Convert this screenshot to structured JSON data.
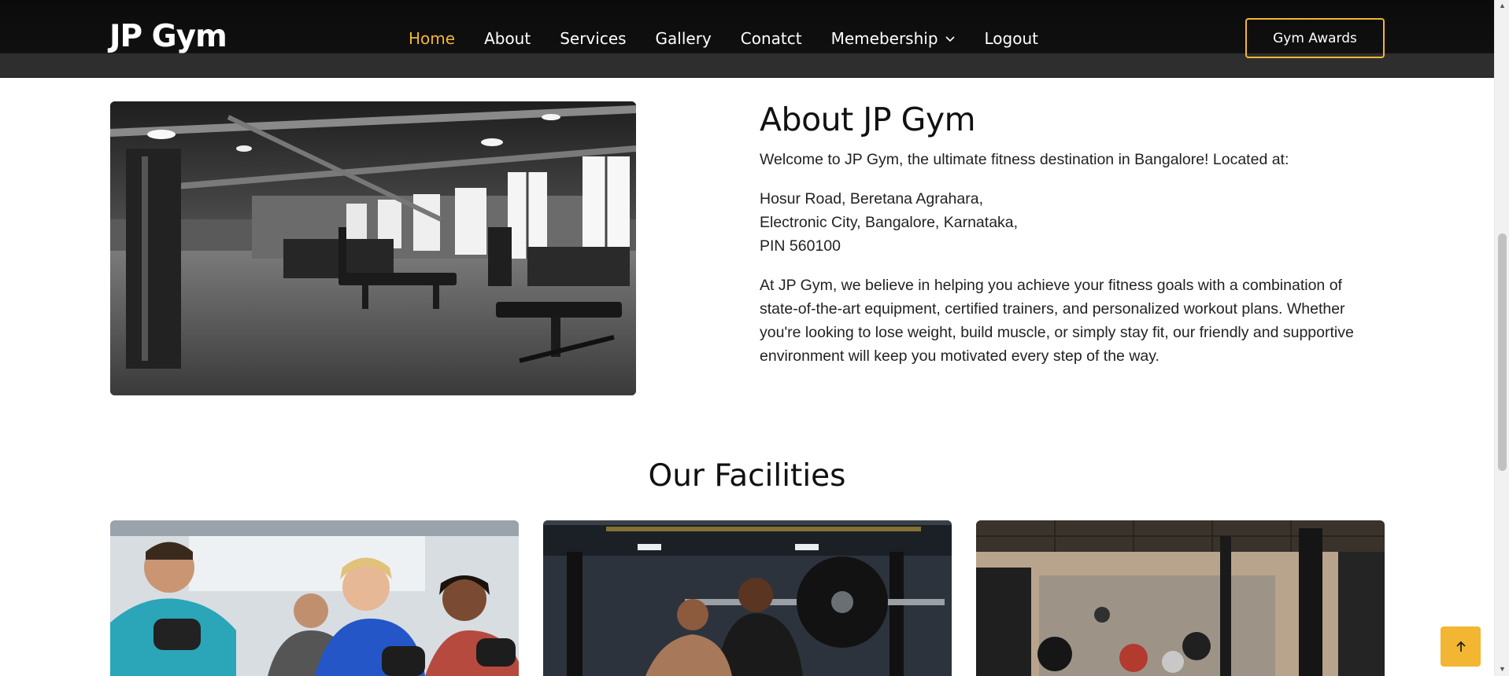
{
  "header": {
    "brand": "JP Gym",
    "nav": [
      {
        "label": "Home",
        "active": true
      },
      {
        "label": "About"
      },
      {
        "label": "Services"
      },
      {
        "label": "Gallery"
      },
      {
        "label": "Conatct"
      },
      {
        "label": "Memebership",
        "icon": "chevron-down-icon"
      },
      {
        "label": "Logout"
      }
    ],
    "cta_label": "Gym Awards"
  },
  "about": {
    "title": "About JP Gym",
    "intro": "Welcome to JP Gym, the ultimate fitness destination in Bangalore! Located at:",
    "address": [
      "Hosur Road, Beretana Agrahara,",
      "Electronic City, Bangalore, Karnataka,",
      "PIN 560100"
    ],
    "body": "At JP Gym, we believe in helping you achieve your fitness goals with a combination of state-of-the-art equipment, certified trainers, and personalized workout plans. Whether you're looking to lose weight, build muscle, or simply stay fit, our friendly and supportive environment will keep you motivated every step of the way."
  },
  "facilities": {
    "title": "Our Facilities"
  },
  "colors": {
    "accent": "#f2b632",
    "header_bg": "#0b0b0b",
    "header_strip": "#2e2e2e"
  },
  "icons": {
    "back_to_top": "arrow-up-icon"
  }
}
